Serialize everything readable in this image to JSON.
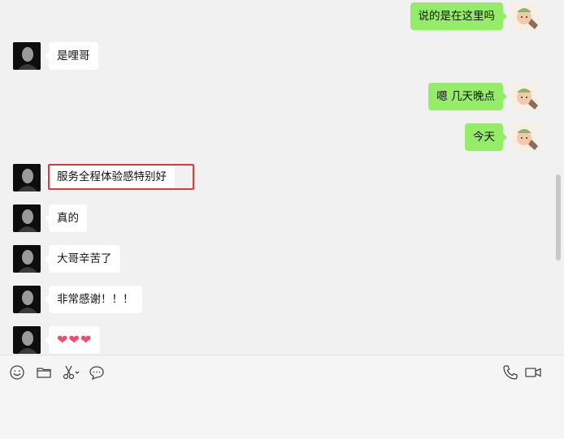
{
  "messages": [
    {
      "side": "right",
      "text": "说的是在这里吗"
    },
    {
      "side": "left",
      "text": "是哩哥"
    },
    {
      "side": "right",
      "text": "嗯 几天晚点"
    },
    {
      "side": "right",
      "text": "今天"
    },
    {
      "side": "left",
      "text": "服务全程体验感特别好",
      "highlighted": true
    },
    {
      "side": "left",
      "text": "真的"
    },
    {
      "side": "left",
      "text": "大哥辛苦了"
    },
    {
      "side": "left",
      "text": "非常感谢！！！"
    },
    {
      "side": "left",
      "text": "❤❤❤"
    }
  ],
  "toolbar": {
    "left_icons": [
      "emoji-icon",
      "folder-icon",
      "scissors-icon",
      "chat-bubble-icon"
    ],
    "right_icons": [
      "phone-icon",
      "video-icon"
    ]
  },
  "colors": {
    "self_bubble": "#95ec69",
    "other_bubble": "#ffffff",
    "highlight": "#e0383e"
  }
}
